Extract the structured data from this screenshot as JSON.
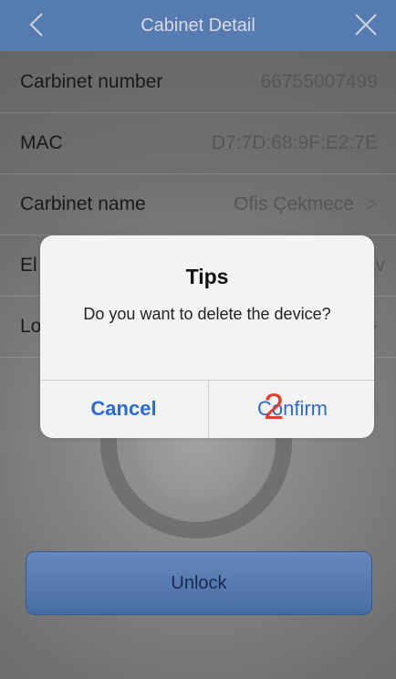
{
  "header": {
    "title": "Cabinet Detail",
    "back_icon": "chevron-left-icon",
    "close_icon": "close-icon"
  },
  "rows": [
    {
      "label": "Carbinet number",
      "value": "66755007499"
    },
    {
      "label": "MAC",
      "value": "D7:7D:68:9F:E2:7E"
    },
    {
      "label": "Carbinet name",
      "value": "Ofis Çekmece",
      "chevron": ">"
    },
    {
      "label": "El",
      "value": "nv"
    },
    {
      "label": "Lo",
      "chevron": ">"
    }
  ],
  "unlock_button": {
    "label": "Unlock"
  },
  "dialog": {
    "title": "Tips",
    "message": "Do you want to delete the device?",
    "cancel_label": "Cancel",
    "confirm_label": "Confirm"
  },
  "annotation": {
    "step": "2",
    "color": "#e33b2e"
  },
  "colors": {
    "header_bg": "#5e86bf",
    "button_blue": "#2d6ad3"
  }
}
